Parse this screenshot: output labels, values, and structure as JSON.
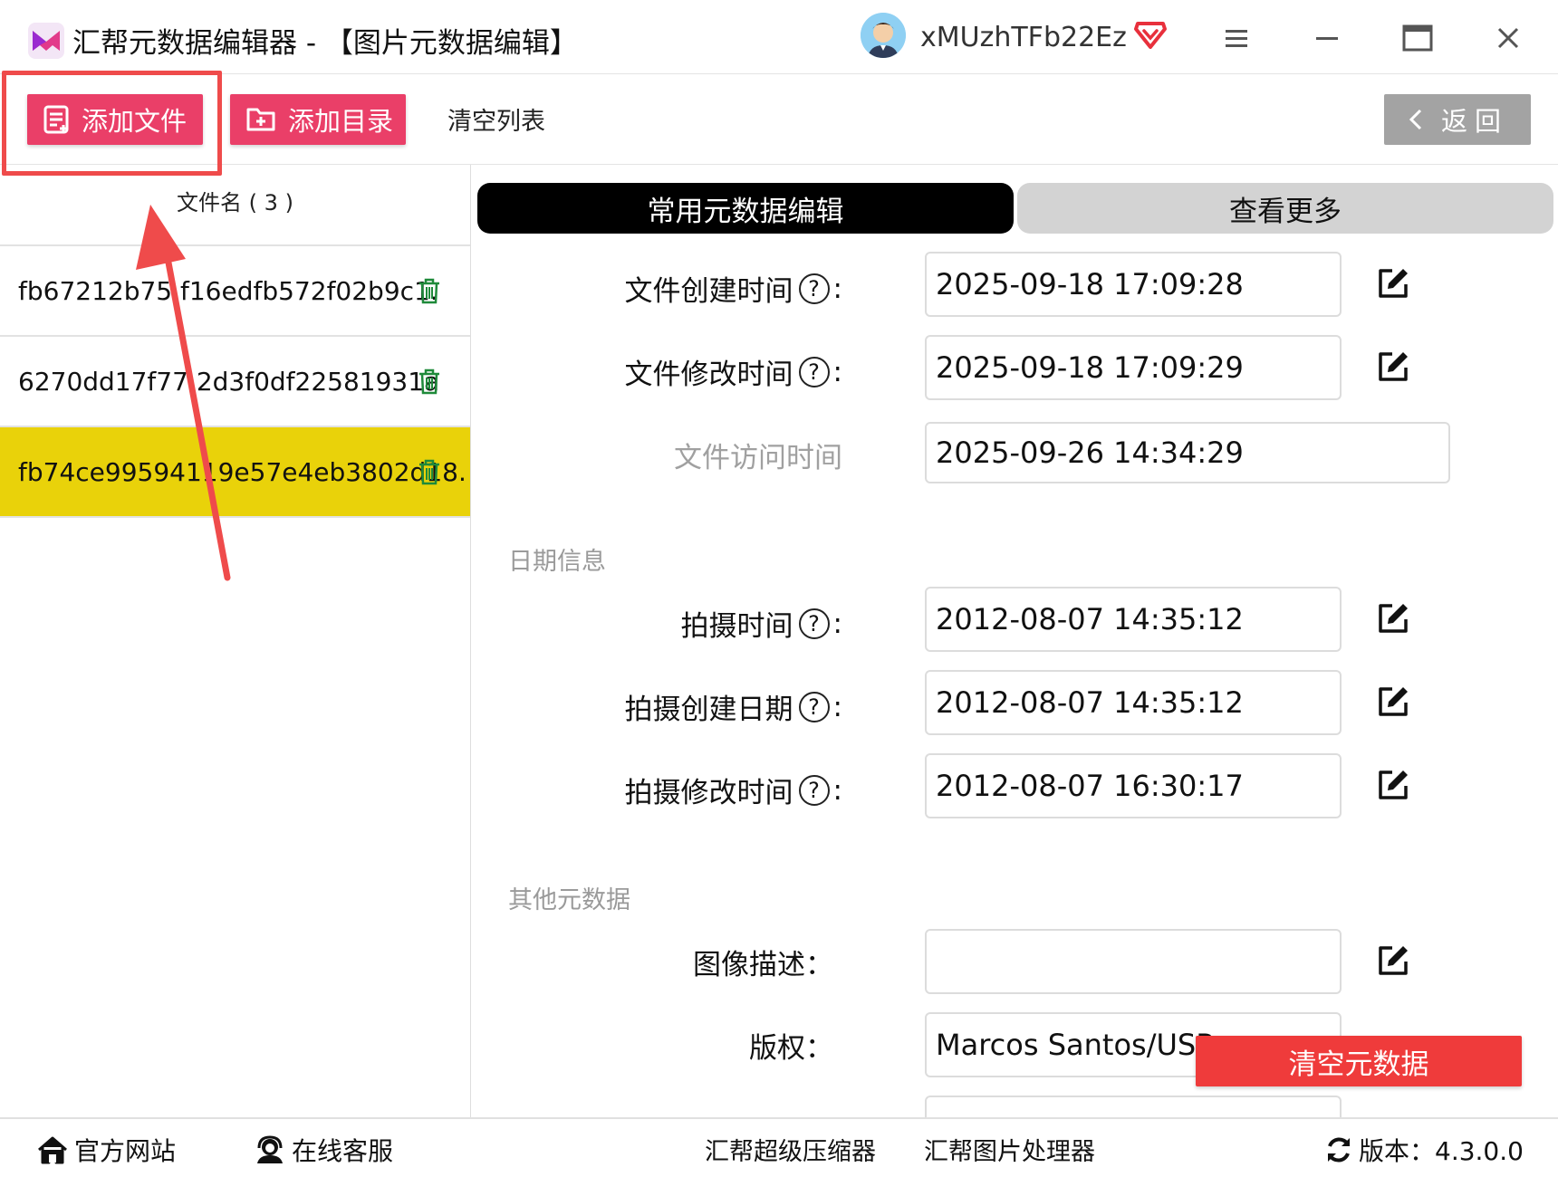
{
  "window": {
    "title": "汇帮元数据编辑器 - 【图片元数据编辑】",
    "username": "xMUzhTFb22Ez"
  },
  "toolbar": {
    "add_file_label": "添加文件",
    "add_dir_label": "添加目录",
    "clear_list_label": "清空列表",
    "back_label": "返回"
  },
  "file_list": {
    "header": "文件名 ( 3 )",
    "items": [
      {
        "name": "fb67212b75 f16edfb572f02b9c1.",
        "selected": false
      },
      {
        "name": "6270dd17f77 2d3f0df22581931a",
        "selected": false
      },
      {
        "name": "fb74ce99594119e57e4eb3802d18.",
        "selected": true
      }
    ]
  },
  "tabs": {
    "active": "常用元数据编辑",
    "more": "查看更多"
  },
  "fields": {
    "file_created": {
      "label": "文件创建时间",
      "value": "2025-09-18 17:09:28"
    },
    "file_modified": {
      "label": "文件修改时间",
      "value": "2025-09-18 17:09:29"
    },
    "file_accessed": {
      "label": "文件访问时间",
      "value": "2025-09-26 14:34:29"
    },
    "date_section": "日期信息",
    "shot_time": {
      "label": "拍摄时间",
      "value": "2012-08-07 14:35:12"
    },
    "shot_created": {
      "label": "拍摄创建日期",
      "value": "2012-08-07 14:35:12"
    },
    "shot_modified": {
      "label": "拍摄修改时间",
      "value": "2012-08-07 16:30:17"
    },
    "other_section": "其他元数据",
    "image_desc": {
      "label": "图像描述：",
      "value": ""
    },
    "copyright": {
      "label": "版权：",
      "value": "Marcos Santos/USP"
    }
  },
  "clear_meta_label": "清空元数据",
  "statusbar": {
    "website": "官方网站",
    "support": "在线客服",
    "compressor": "汇帮超级压缩器",
    "image_tool": "汇帮图片处理器",
    "version": "版本：4.3.0.0"
  },
  "colors": {
    "accent_pink": "#ea3f68",
    "selected_row": "#e9d20a",
    "annotation_red": "#ef4b4b",
    "clear_red": "#ef3b3b"
  }
}
